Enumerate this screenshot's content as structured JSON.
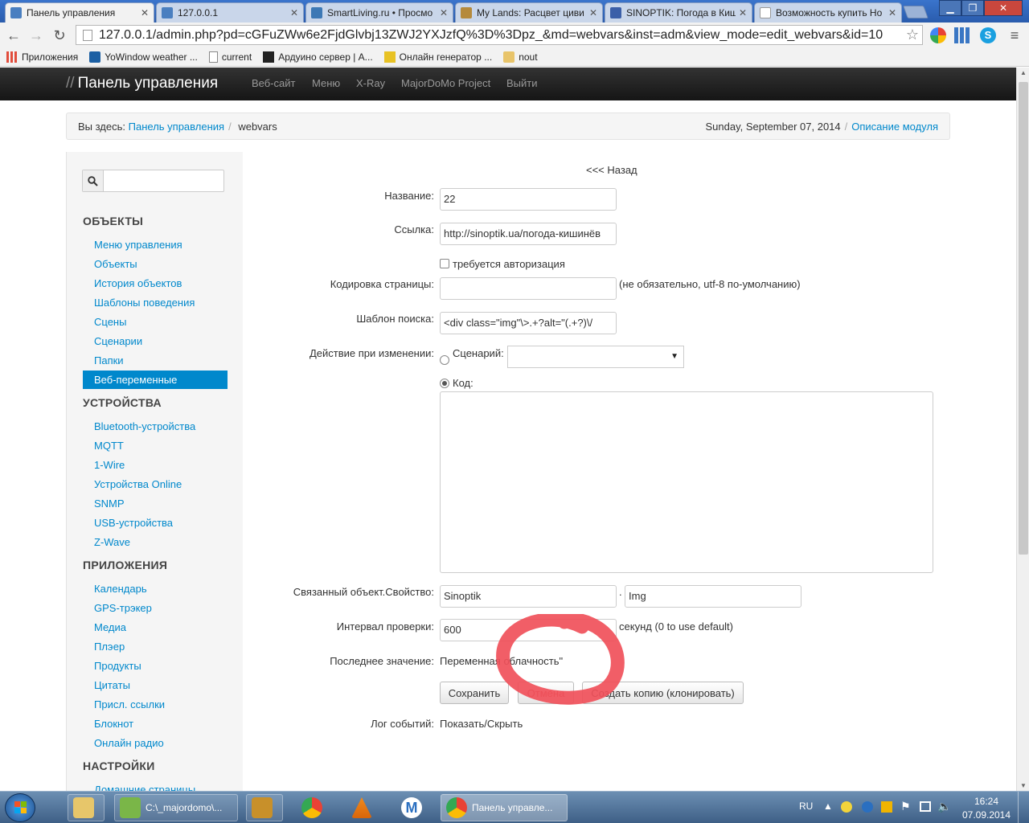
{
  "browser": {
    "tabs": [
      {
        "title": "Панель управления",
        "favicon_color": "#4a7fc0",
        "active": true
      },
      {
        "title": "127.0.0.1",
        "favicon_color": "#4a7fc0",
        "active": false
      },
      {
        "title": "SmartLiving.ru • Просмо",
        "favicon_color": "#3c78b5",
        "active": false
      },
      {
        "title": "My Lands: Расцвет циви",
        "favicon_color": "#b58a3c",
        "active": false
      },
      {
        "title": "SINOPTIK: Погода в Киш",
        "favicon_color": "#3b5fa8",
        "active": false
      },
      {
        "title": "Возможность купить Но",
        "favicon_color": "#ffffff",
        "active": false
      }
    ],
    "url": "127.0.0.1/admin.php?pd=cGFuZWw6e2FjdGlvbj13ZWJ2YXJzfQ%3D%3Dpz_&md=webvars&inst=adm&view_mode=edit_webvars&id=10",
    "bookmarks": [
      {
        "label": "Приложения"
      },
      {
        "label": "YoWindow weather ..."
      },
      {
        "label": "current"
      },
      {
        "label": "Ардуино сервер | A..."
      },
      {
        "label": "Онлайн генератор ..."
      },
      {
        "label": "nout"
      }
    ]
  },
  "navbar": {
    "brand_slashes": "//",
    "brand": "Панель управления",
    "links": [
      "Веб-сайт",
      "Меню",
      "X-Ray",
      "MajorDoMo Project",
      "Выйти"
    ]
  },
  "breadcrumb": {
    "prefix": "Вы здесь:",
    "home": "Панель управления",
    "separator": "/",
    "current": "webvars",
    "date": "Sunday, September 07, 2014",
    "module_link": "Описание модуля"
  },
  "sidebar": {
    "search_placeholder": "",
    "sections": [
      {
        "title": "ОБЪЕКТЫ",
        "items": [
          "Меню управления",
          "Объекты",
          "История объектов",
          "Шаблоны поведения",
          "Сцены",
          "Сценарии",
          "Папки",
          "Веб-переменные"
        ]
      },
      {
        "title": "УСТРОЙСТВА",
        "items": [
          "Bluetooth-устройства",
          "MQTT",
          "1-Wire",
          "Устройства Online",
          "SNMP",
          "USB-устройства",
          "Z-Wave"
        ]
      },
      {
        "title": "ПРИЛОЖЕНИЯ",
        "items": [
          "Календарь",
          "GPS-трэкер",
          "Медиа",
          "Плэер",
          "Продукты",
          "Цитаты",
          "Присл. ссылки",
          "Блокнот",
          "Онлайн радио"
        ]
      },
      {
        "title": "НАСТРОЙКИ",
        "items": [
          "Домашние страницы"
        ]
      }
    ],
    "active_item": "Веб-переменные"
  },
  "form": {
    "back_link": "<<< Назад",
    "name_label": "Название:",
    "name_value": "22",
    "url_label": "Ссылка:",
    "url_value": "http://sinoptik.ua/погода-кишинёв",
    "auth_label": "требуется авторизация",
    "encoding_label": "Кодировка страницы:",
    "encoding_value": "",
    "encoding_hint": "(не обязательно, utf-8 по-умолчанию)",
    "pattern_label": "Шаблон поиска:",
    "pattern_value": "<div class=\"img\"\\>.+?alt=\"(.+?)\\/",
    "action_label": "Действие при изменении:",
    "script_radio_label": "Сценарий:",
    "script_select_value": "",
    "code_radio_label": "Код:",
    "code_value": "",
    "linked_label": "Связанный объект.Свойство:",
    "linked_object": "Sinoptik",
    "linked_dot": ".",
    "linked_property": "Img",
    "interval_label": "Интервал проверки:",
    "interval_value": "600",
    "interval_hint": "секунд (0 to use default)",
    "last_value_label": "Последнее значение:",
    "last_value": "Переменная облачность\"",
    "save_button": "Сохранить",
    "cancel_button": "Отмена",
    "clone_button": "Создать копию (клонировать)",
    "log_label": "Лог событий:",
    "log_link": "Показать/Скрыть"
  },
  "annotation": {
    "color": "#f0505a"
  },
  "taskbar": {
    "items": [
      {
        "label": "C:\\_majordomo\\...",
        "icon_color": "#7ab648"
      },
      {
        "label": "Панель управле...",
        "icon_color": "#dd4b39",
        "active": true
      }
    ],
    "language": "RU",
    "time": "16:24",
    "date": "07.09.2014"
  }
}
